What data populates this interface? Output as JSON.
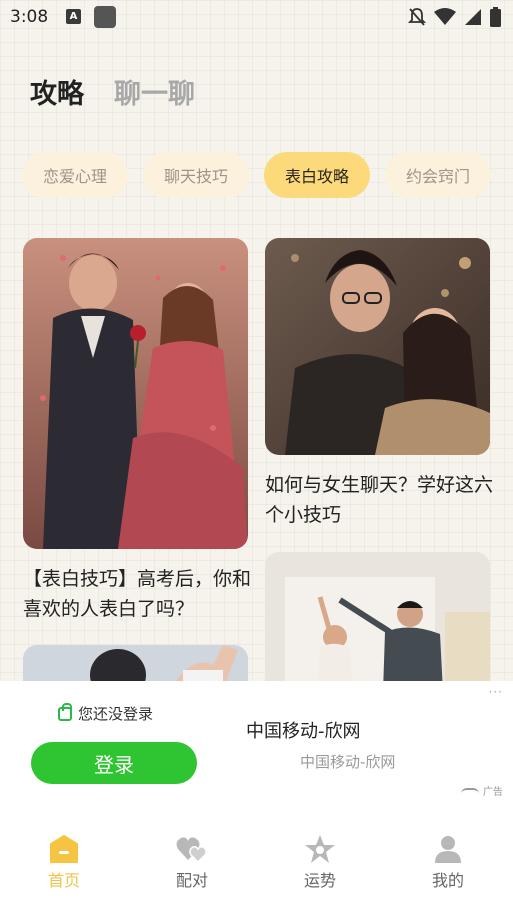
{
  "status_bar": {
    "time": "3:08",
    "a_icon_letter": "A"
  },
  "top_tabs": [
    {
      "label": "攻略",
      "active": true
    },
    {
      "label": "聊一聊",
      "active": false
    }
  ],
  "categories": [
    {
      "label": "恋爱心理",
      "active": false
    },
    {
      "label": "聊天技巧",
      "active": false
    },
    {
      "label": "表白攻略",
      "active": true
    },
    {
      "label": "约会窍门",
      "active": false
    }
  ],
  "cards": [
    {
      "title": "【表白技巧】高考后，你和喜欢的人表白了吗？",
      "image": "illustration-couple-rose"
    },
    {
      "title": "如何与女生聊天？学好这六个小技巧",
      "image": "illustration-couple-talk"
    },
    {
      "title": "",
      "image": "photo-couple-dancing"
    },
    {
      "title": "",
      "image": "photo-couple-hands"
    }
  ],
  "ad": {
    "login_hint": "您还没登录",
    "login_button": "登录",
    "title": "中国移动-欣网",
    "subtitle": "中国移动-欣网",
    "tag": "广告",
    "more": "···"
  },
  "bottom_nav": [
    {
      "label": "首页",
      "icon": "home-icon",
      "active": true
    },
    {
      "label": "配对",
      "icon": "hearts-icon",
      "active": false
    },
    {
      "label": "运势",
      "icon": "star-icon",
      "active": false
    },
    {
      "label": "我的",
      "icon": "profile-icon",
      "active": false
    }
  ],
  "colors": {
    "accent": "#fcd97a",
    "pill_bg": "#fbf1dc",
    "login_green": "#2fc532",
    "nav_active": "#f0c34a"
  }
}
